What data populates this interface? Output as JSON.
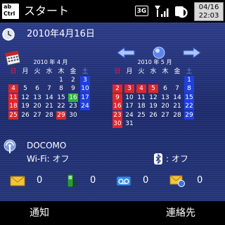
{
  "status_bar": {
    "app_icon_text": "ab Ctrl",
    "title": "スタート",
    "network_label": "3G",
    "clock_date": "04/16",
    "clock_time": "22:03"
  },
  "today": {
    "date_text": "2010年4月16日"
  },
  "calendar": {
    "weekday_labels": [
      "日",
      "月",
      "火",
      "水",
      "木",
      "金",
      "土"
    ],
    "months": [
      {
        "title": "2010 年 4 月",
        "weeks": [
          [
            "",
            "",
            "",
            "",
            "1",
            "2",
            "3"
          ],
          [
            "4",
            "5",
            "6",
            "7",
            "8",
            "9",
            "10"
          ],
          [
            "11",
            "12",
            "13",
            "14",
            "15",
            "16",
            "17"
          ],
          [
            "18",
            "19",
            "20",
            "21",
            "22",
            "23",
            "24"
          ],
          [
            "25",
            "26",
            "27",
            "28",
            "29",
            "30",
            ""
          ]
        ],
        "holidays": [
          "29"
        ],
        "today": "16"
      },
      {
        "title": "2010 年 5 月",
        "weeks": [
          [
            "",
            "",
            "",
            "",
            "",
            "",
            "1"
          ],
          [
            "2",
            "3",
            "4",
            "5",
            "6",
            "7",
            "8"
          ],
          [
            "9",
            "10",
            "11",
            "12",
            "13",
            "14",
            "15"
          ],
          [
            "16",
            "17",
            "18",
            "19",
            "20",
            "21",
            "22"
          ],
          [
            "23",
            "24",
            "25",
            "26",
            "27",
            "28",
            "29"
          ],
          [
            "30",
            "31",
            "",
            "",
            "",
            "",
            ""
          ]
        ],
        "holidays": [
          "3",
          "4",
          "5"
        ],
        "today": ""
      }
    ]
  },
  "connectivity": {
    "carrier": "DOCOMO",
    "wifi": "Wi-Fi: オフ",
    "bluetooth": ": オフ"
  },
  "notifications": [
    {
      "icon": "mail-icon",
      "count": "0"
    },
    {
      "icon": "missed-call-icon",
      "count": "0"
    },
    {
      "icon": "voicemail-icon",
      "count": "0"
    },
    {
      "icon": "email-icon",
      "count": "0"
    }
  ],
  "softkeys": {
    "left": "通知",
    "right": "連絡先"
  },
  "colors": {
    "sunday": "#e0262b",
    "saturday": "#1f3fe0",
    "today": "#2fb43a",
    "panel": "#24327a"
  }
}
